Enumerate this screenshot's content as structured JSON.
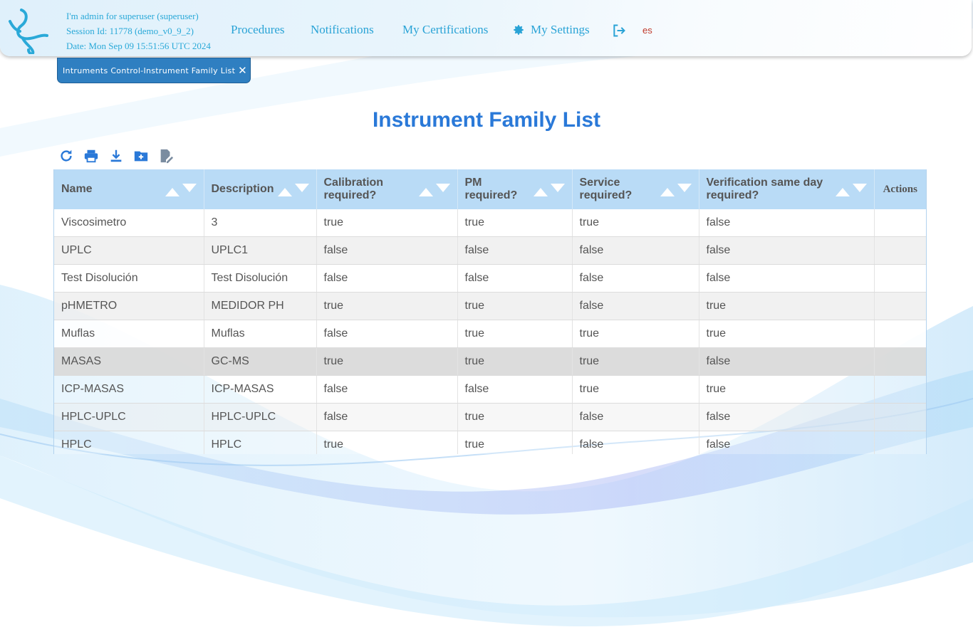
{
  "session": {
    "user_line": "I'm admin for superuser (superuser)",
    "session_line": "Session Id: 11778 (demo_v0_9_2)",
    "date_line": "Date: Mon Sep 09 15:51:56 UTC 2024"
  },
  "nav": {
    "procedures": "Procedures",
    "notifications": "Notifications",
    "certifications": "My Certifications",
    "settings": "My Settings",
    "language": "es"
  },
  "tab": {
    "label": "Intruments Control-Instrument Family List",
    "close": "✕"
  },
  "page_title": "Instrument Family List",
  "toolbar_icons": [
    "refresh-icon",
    "print-icon",
    "download-icon",
    "add-folder-icon",
    "edit-document-icon"
  ],
  "colors": {
    "accent": "#2a79d8",
    "header_bg": "#b9dbf6",
    "tab_bg": "#2f7fc1",
    "lang": "#c0392b"
  },
  "table": {
    "columns": [
      "Name",
      "Description",
      "Calibration required?",
      "PM required?",
      "Service required?",
      "Verification same day required?",
      "Actions"
    ],
    "rows": [
      [
        "Viscosimetro",
        "3",
        "true",
        "true",
        "true",
        "false",
        ""
      ],
      [
        "UPLC",
        "UPLC1",
        "false",
        "false",
        "false",
        "false",
        ""
      ],
      [
        "Test Disolución",
        "Test Disolución",
        "false",
        "false",
        "false",
        "false",
        ""
      ],
      [
        "pHMETRO",
        "MEDIDOR PH",
        "true",
        "true",
        "false",
        "true",
        ""
      ],
      [
        "Muflas",
        "Muflas",
        "false",
        "true",
        "true",
        "true",
        ""
      ],
      [
        "MASAS",
        "GC-MS",
        "true",
        "true",
        "true",
        "false",
        ""
      ],
      [
        "ICP-MASAS",
        "ICP-MASAS",
        "false",
        "false",
        "true",
        "true",
        ""
      ],
      [
        "HPLC-UPLC",
        "HPLC-UPLC",
        "false",
        "true",
        "false",
        "false",
        ""
      ],
      [
        "HPLC",
        "HPLC",
        "true",
        "true",
        "false",
        "false",
        ""
      ]
    ]
  }
}
